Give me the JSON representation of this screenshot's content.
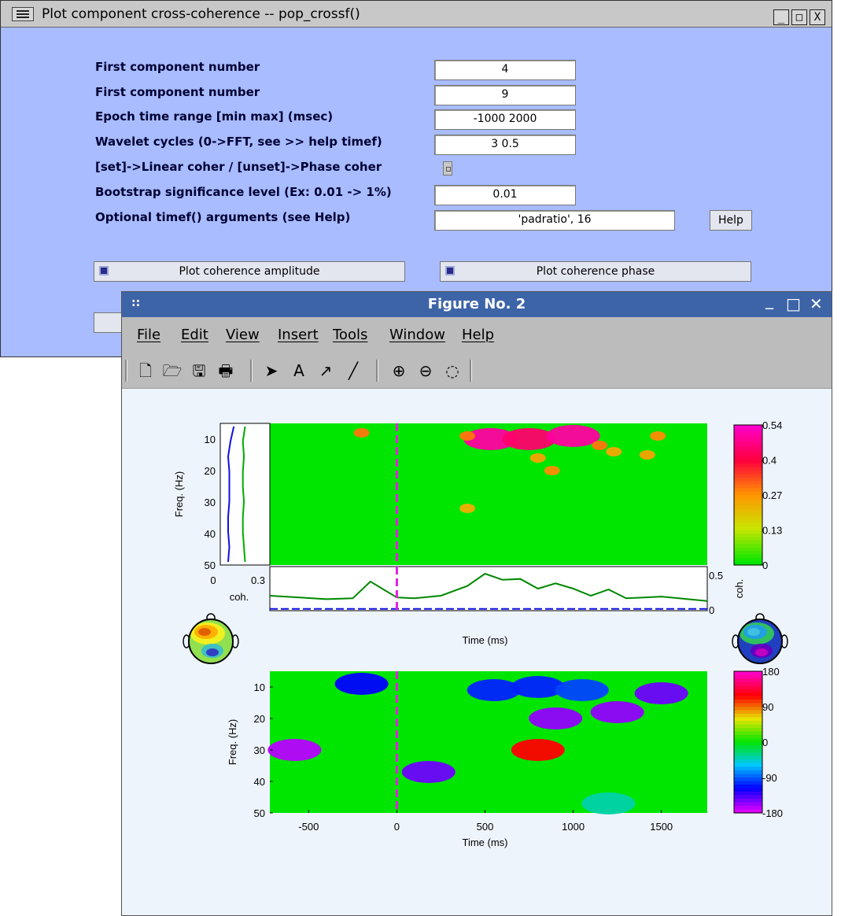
{
  "dialog": {
    "title": "Plot component cross-coherence -- pop_crossf()",
    "window_buttons": [
      "_",
      "□",
      "X"
    ],
    "fields": [
      {
        "label": "First component number",
        "value": "4"
      },
      {
        "label": "First component number",
        "value": "9"
      },
      {
        "label": "Epoch time range [min max] (msec)",
        "value": "-1000 2000"
      },
      {
        "label": "Wavelet cycles (0->FFT, see >> help timef)",
        "value": "3 0.5"
      },
      {
        "label": "[set]->Linear coher / [unset]->Phase coher",
        "value": ""
      },
      {
        "label": "Bootstrap significance level (Ex: 0.01 -> 1%)",
        "value": "0.01"
      },
      {
        "label": "Optional timef() arguments (see Help)",
        "value": "'padratio', 16"
      }
    ],
    "help_button": "Help",
    "plot_amplitude_button": "Plot coherence amplitude",
    "plot_phase_button": "Plot coherence phase"
  },
  "figure": {
    "title": "Figure No. 2",
    "menu": [
      "File",
      "Edit",
      "View",
      "Insert",
      "Tools",
      "Window",
      "Help"
    ],
    "toolbar_icons": [
      "new-file-icon",
      "open-folder-icon",
      "save-icon",
      "print-icon",
      "select-arrow-icon",
      "text-icon",
      "arrow-icon",
      "line-icon",
      "zoom-in-icon",
      "zoom-out-icon",
      "rotate-icon"
    ],
    "toolbar_glyphs": [
      "🗋",
      "🗁",
      "🖫",
      "🖶",
      "➤",
      "A",
      "↗",
      "╱",
      "⊕",
      "⊖",
      "◌"
    ]
  },
  "chart_data": [
    {
      "type": "heatmap",
      "name": "coherence-amplitude",
      "xlabel": "Time (ms)",
      "ylabel": "Freq. (Hz)",
      "xlim": [
        -720,
        1760
      ],
      "ylim": [
        5,
        50
      ],
      "xticks": [
        -500,
        0,
        500,
        1000,
        1500
      ],
      "yticks": [
        10,
        20,
        30,
        40,
        50
      ],
      "colorbar": {
        "label": "",
        "ticks": [
          "0.54",
          "0.4",
          "0.27",
          "0.13",
          "0"
        ],
        "range": [
          0,
          0.54
        ]
      },
      "background_value": 0,
      "blobs": [
        {
          "t": 530,
          "f": 10,
          "value": 0.5
        },
        {
          "t": 750,
          "f": 10,
          "value": 0.45
        },
        {
          "t": 1000,
          "f": 9,
          "value": 0.5
        },
        {
          "t": 400,
          "f": 9,
          "value": 0.3
        },
        {
          "t": 1150,
          "f": 12,
          "value": 0.3
        },
        {
          "t": -200,
          "f": 8,
          "value": 0.3
        },
        {
          "t": 880,
          "f": 20,
          "value": 0.28
        },
        {
          "t": 1480,
          "f": 9,
          "value": 0.28
        },
        {
          "t": 1420,
          "f": 15,
          "value": 0.25
        },
        {
          "t": 1230,
          "f": 14,
          "value": 0.24
        },
        {
          "t": 800,
          "f": 16,
          "value": 0.25
        },
        {
          "t": 400,
          "f": 32,
          "value": 0.23
        }
      ],
      "marker_time": 0,
      "freq_marginal": {
        "xlim": [
          0,
          0.3
        ],
        "xlabel": "coh.",
        "xticks": [
          "0",
          "0.3"
        ],
        "series": [
          {
            "color": "#1010e0",
            "values": [
              0.12,
              0.09,
              0.07,
              0.08,
              0.08,
              0.08,
              0.07,
              0.07,
              0.08,
              0.07
            ]
          },
          {
            "color": "#00aa00",
            "values": [
              0.22,
              0.2,
              0.21,
              0.2,
              0.2,
              0.21,
              0.2,
              0.2,
              0.21,
              0.22
            ]
          }
        ]
      },
      "time_marginal": {
        "ylim": [
          0,
          0.5
        ],
        "ylabel": "coh.",
        "yticks": [
          "0.5",
          "0"
        ],
        "series": [
          {
            "color": "#008800",
            "x": [
              -720,
              -550,
              -400,
              -250,
              -150,
              0,
              100,
              250,
              400,
              500,
              600,
              700,
              800,
              900,
              1000,
              1100,
              1200,
              1300,
              1400,
              1500,
              1600,
              1760
            ],
            "values": [
              0.17,
              0.15,
              0.13,
              0.14,
              0.33,
              0.15,
              0.14,
              0.17,
              0.28,
              0.42,
              0.35,
              0.36,
              0.25,
              0.31,
              0.25,
              0.17,
              0.24,
              0.14,
              0.15,
              0.16,
              0.14,
              0.11
            ]
          },
          {
            "color": "#1010e0",
            "x": [
              -720,
              1760
            ],
            "values": [
              0.02,
              0.02
            ]
          }
        ]
      }
    },
    {
      "type": "heatmap",
      "name": "coherence-phase",
      "xlabel": "Time (ms)",
      "ylabel": "Freq. (Hz)",
      "xlim": [
        -720,
        1760
      ],
      "ylim": [
        5,
        50
      ],
      "xticks": [
        -500,
        0,
        500,
        1000,
        1500
      ],
      "yticks": [
        10,
        20,
        30,
        40,
        50
      ],
      "colorbar": {
        "label": "",
        "ticks": [
          "180",
          "90",
          "0",
          "-90",
          "-180"
        ],
        "range": [
          -180,
          180
        ]
      },
      "background_value": 0,
      "blobs": [
        {
          "t": -200,
          "f": 9,
          "value": -120
        },
        {
          "t": 550,
          "f": 11,
          "value": -110
        },
        {
          "t": 800,
          "f": 10,
          "value": -110
        },
        {
          "t": 1050,
          "f": 11,
          "value": -100
        },
        {
          "t": 1500,
          "f": 12,
          "value": -150
        },
        {
          "t": 900,
          "f": 20,
          "value": -160
        },
        {
          "t": 1250,
          "f": 18,
          "value": -160
        },
        {
          "t": 800,
          "f": 30,
          "value": 120
        },
        {
          "t": 180,
          "f": 37,
          "value": -150
        },
        {
          "t": 1200,
          "f": 47,
          "value": -40
        },
        {
          "t": -580,
          "f": 30,
          "value": -170
        }
      ],
      "marker_time": 0
    }
  ],
  "topos": [
    {
      "label": ""
    },
    {
      "label": ""
    }
  ]
}
